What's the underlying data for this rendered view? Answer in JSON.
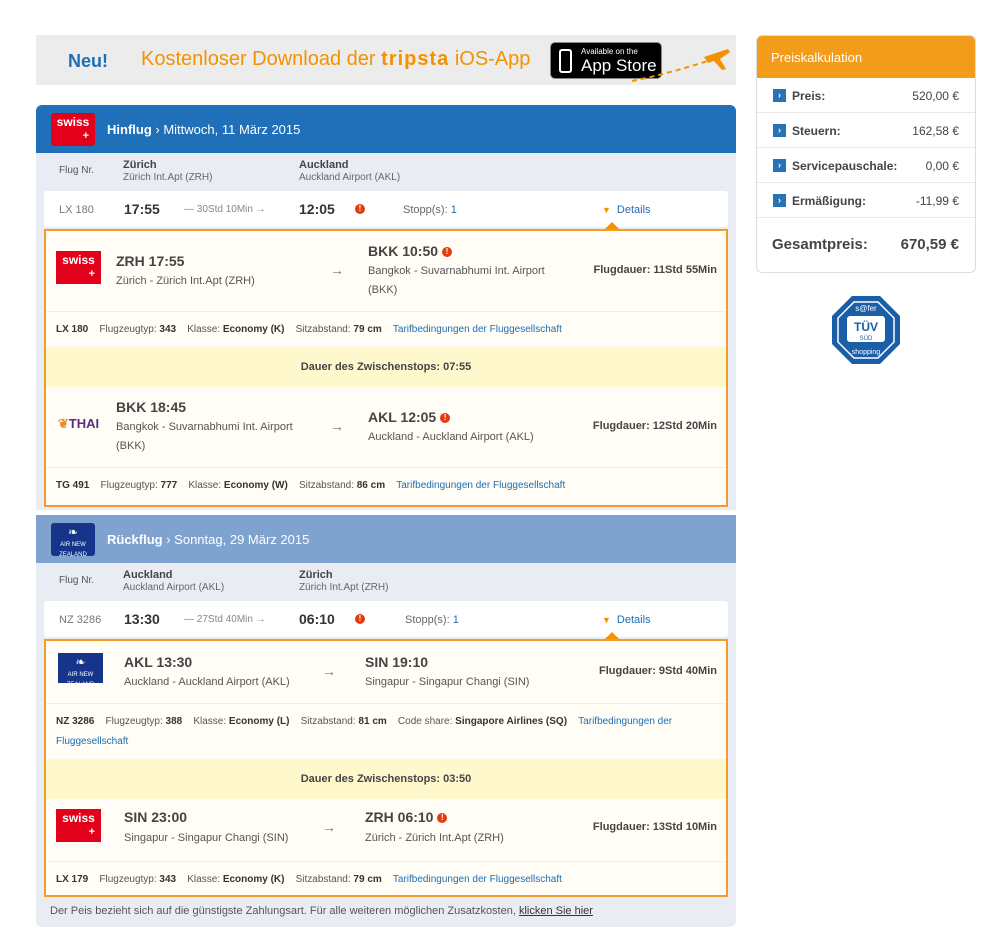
{
  "banner": {
    "neu": "Neu!",
    "promo_pre": "Kostenloser Download der ",
    "brand": "tripsta",
    "promo_post": " iOS-App",
    "appstore_small": "Available on the",
    "appstore_big": "App Store"
  },
  "outbound": {
    "title_bold": "Hinflug",
    "title_rest": " › Mittwoch, 11 März 2015",
    "airline_logo": "SWISS",
    "flugnr_label": "Flug Nr.",
    "from_city": "Zürich",
    "from_airport": "Zürich Int.Apt (ZRH)",
    "to_city": "Auckland",
    "to_airport": "Auckland Airport (AKL)",
    "summary": {
      "flight": "LX 180",
      "dep": "17:55",
      "duration": "— 30Std 10Min →",
      "arr": "12:05",
      "stops_label": "Stopp(s): ",
      "stops": "1",
      "details": "Details"
    },
    "segments": [
      {
        "logo": "SWISS",
        "dep_code": "ZRH 17:55",
        "dep_loc": "Zürich - Zürich Int.Apt (ZRH)",
        "arr_code": "BKK 10:50",
        "arr_loc": "Bangkok - Suvarnabhumi Int. Airport (BKK)",
        "duration": "Flugdauer: 11Std 55Min",
        "info": {
          "flight": "LX 180",
          "type_label": "Flugzeugtyp: ",
          "type": "343",
          "class_label": "Klasse: ",
          "class": "Economy (K)",
          "seat_label": "Sitzabstand: ",
          "seat": "79 cm",
          "tarif": "Tarifbedingungen der Fluggesellschaft"
        }
      },
      {
        "logo": "THAI",
        "dep_code": "BKK 18:45",
        "dep_loc": "Bangkok - Suvarnabhumi Int. Airport (BKK)",
        "arr_code": "AKL 12:05",
        "arr_loc": "Auckland - Auckland Airport (AKL)",
        "duration": "Flugdauer: 12Std 20Min",
        "info": {
          "flight": "TG 491",
          "type_label": "Flugzeugtyp: ",
          "type": "777",
          "class_label": "Klasse: ",
          "class": "Economy (W)",
          "seat_label": "Sitzabstand: ",
          "seat": "86 cm",
          "tarif": "Tarifbedingungen der Fluggesellschaft"
        }
      }
    ],
    "stopover": "Dauer des Zwischenstops: 07:55"
  },
  "inbound": {
    "title_bold": "Rückflug",
    "title_rest": " › Sonntag, 29 März 2015",
    "airline_logo": "AIR NEW ZEALAND",
    "flugnr_label": "Flug Nr.",
    "from_city": "Auckland",
    "from_airport": "Auckland Airport (AKL)",
    "to_city": "Zürich",
    "to_airport": "Zürich Int.Apt (ZRH)",
    "summary": {
      "flight": "NZ 3286",
      "dep": "13:30",
      "duration": "— 27Std 40Min →",
      "arr": "06:10",
      "stops_label": "Stopp(s): ",
      "stops": "1",
      "details": "Details"
    },
    "segments": [
      {
        "logo": "AIR NEW ZEALAND",
        "dep_code": "AKL 13:30",
        "dep_loc": "Auckland - Auckland Airport (AKL)",
        "arr_code": "SIN 19:10",
        "arr_loc": "Singapur - Singapur Changi (SIN)",
        "duration": "Flugdauer: 9Std 40Min",
        "info": {
          "flight": "NZ 3286",
          "type_label": "Flugzeugtyp: ",
          "type": "388",
          "class_label": "Klasse: ",
          "class": "Economy (L)",
          "seat_label": "Sitzabstand: ",
          "seat": "81 cm",
          "codeshare_label": "Code share: ",
          "codeshare": "Singapore Airlines (SQ)",
          "tarif": "Tarifbedingungen der Fluggesellschaft"
        }
      },
      {
        "logo": "SWISS",
        "dep_code": "SIN 23:00",
        "dep_loc": "Singapur - Singapur Changi (SIN)",
        "arr_code": "ZRH 06:10",
        "arr_loc": "Zürich - Zürich Int.Apt (ZRH)",
        "duration": "Flugdauer: 13Std 10Min",
        "info": {
          "flight": "LX 179",
          "type_label": "Flugzeugtyp: ",
          "type": "343",
          "class_label": "Klasse: ",
          "class": "Economy (K)",
          "seat_label": "Sitzabstand: ",
          "seat": "79 cm",
          "tarif": "Tarifbedingungen der Fluggesellschaft"
        }
      }
    ],
    "stopover": "Dauer des Zwischenstops: 03:50"
  },
  "footer": {
    "text": "Der Peis bezieht sich auf die günstigste Zahlungsart. Für alle weiteren möglichen Zusatzkosten, ",
    "link": "klicken Sie hier"
  },
  "price": {
    "title": "Preiskalkulation",
    "rows": [
      {
        "label": "Preis:",
        "value": "520,00 €"
      },
      {
        "label": "Steuern:",
        "value": "162,58 €"
      },
      {
        "label": "Servicepauschale:",
        "value": "0,00 €"
      },
      {
        "label": "Ermäßigung:",
        "value": "-11,99 €"
      }
    ],
    "total_label": "Gesamtpreis:",
    "total": "670,59 €"
  },
  "tuv": {
    "top": "s@fer",
    "main": "TÜV",
    "sub": "SÜD",
    "bottom": "shopping"
  },
  "colors": {
    "outbound_header": "#1f70b8",
    "inbound_header": "#7fa3cf",
    "accent": "#f39b2d",
    "link": "#1f6db3"
  }
}
